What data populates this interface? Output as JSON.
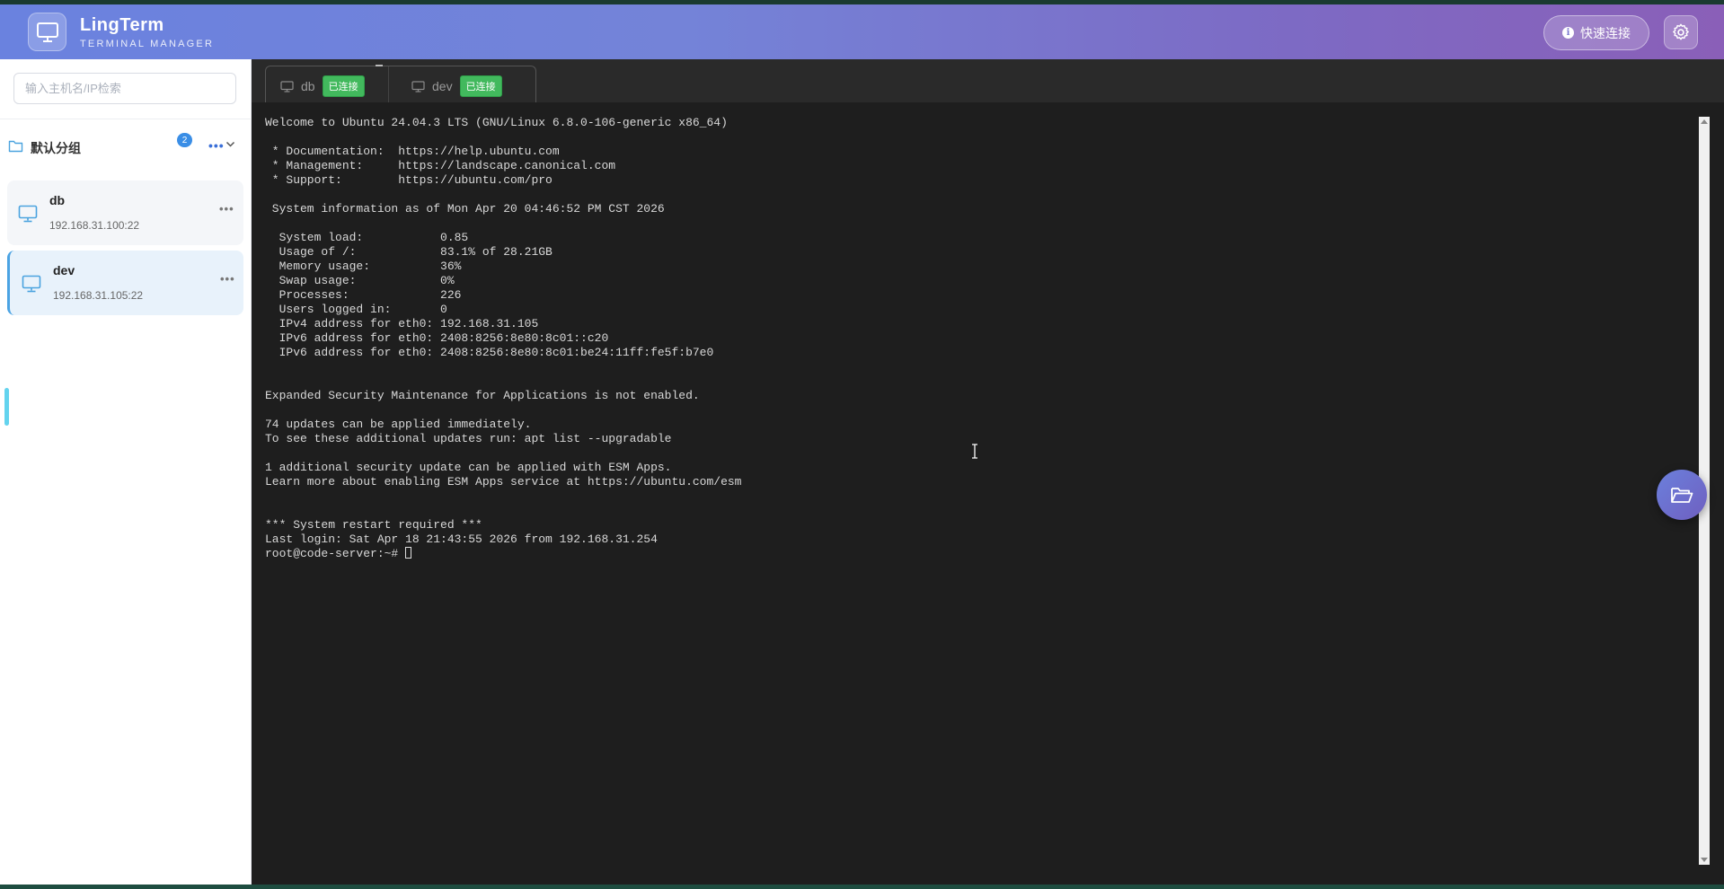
{
  "header": {
    "title": "LingTerm",
    "subtitle": "TERMINAL MANAGER",
    "quick_connect_label": "快速连接"
  },
  "sidebar": {
    "search_placeholder": "输入主机名/IP检索",
    "group": {
      "name": "默认分组",
      "count": "2"
    },
    "hosts": [
      {
        "name": "db",
        "address": "192.168.31.100:22",
        "active": false
      },
      {
        "name": "dev",
        "address": "192.168.31.105:22",
        "active": true
      }
    ]
  },
  "tabs": [
    {
      "name": "db",
      "status": "已连接"
    },
    {
      "name": "dev",
      "status": "已连接"
    }
  ],
  "terminal": {
    "output": "Welcome to Ubuntu 24.04.3 LTS (GNU/Linux 6.8.0-106-generic x86_64)\n\n * Documentation:  https://help.ubuntu.com\n * Management:     https://landscape.canonical.com\n * Support:        https://ubuntu.com/pro\n\n System information as of Mon Apr 20 04:46:52 PM CST 2026\n\n  System load:           0.85\n  Usage of /:            83.1% of 28.21GB\n  Memory usage:          36%\n  Swap usage:            0%\n  Processes:             226\n  Users logged in:       0\n  IPv4 address for eth0: 192.168.31.105\n  IPv6 address for eth0: 2408:8256:8e80:8c01::c20\n  IPv6 address for eth0: 2408:8256:8e80:8c01:be24:11ff:fe5f:b7e0\n\n\nExpanded Security Maintenance for Applications is not enabled.\n\n74 updates can be applied immediately.\nTo see these additional updates run: apt list --upgradable\n\n1 additional security update can be applied with ESM Apps.\nLearn more about enabling ESM Apps service at https://ubuntu.com/esm\n\n\n*** System restart required ***\nLast login: Sat Apr 18 21:43:55 2026 from 192.168.31.254",
    "prompt": "root@code-server:~# "
  },
  "colors": {
    "header_gradient_start": "#6a82df",
    "header_gradient_end": "#8a5fb8",
    "status_green": "#42b95d",
    "accent_blue": "#3a8ee6",
    "terminal_bg": "#1e1e1e"
  },
  "icons": {
    "logo": "monitor-icon",
    "quick_connect": "info-icon",
    "settings": "gear-icon",
    "group": "folder-icon",
    "host": "monitor-icon",
    "fab": "folder-open-icon"
  }
}
